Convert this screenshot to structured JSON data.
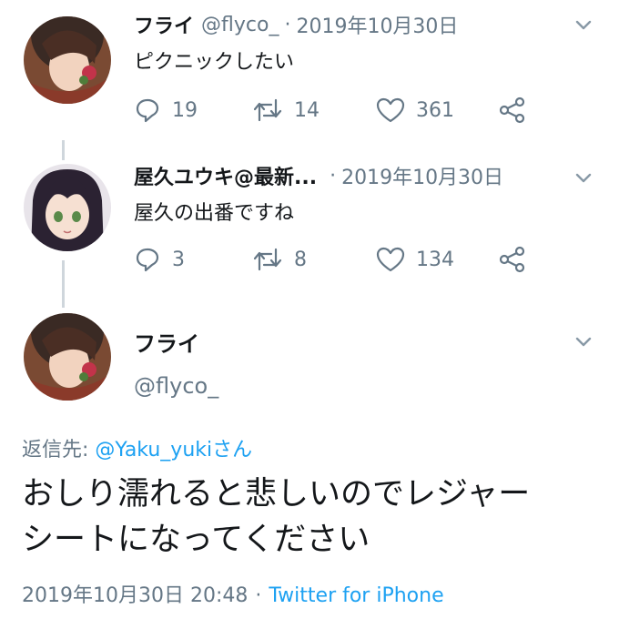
{
  "colors": {
    "text": "#14171a",
    "secondary": "#657786",
    "link": "#1da1f2",
    "thread_line": "#cfd6dc"
  },
  "tweet1": {
    "name": "フライ",
    "handle": "@flyco_",
    "dot": "·",
    "date": "2019年10月30日",
    "text": "ピクニックしたい",
    "replies": "19",
    "retweets": "14",
    "likes": "361"
  },
  "tweet2": {
    "name": "屋久ユウキ@最新...",
    "dot": "·",
    "date": "2019年10月30日",
    "text": "屋久の出番ですね",
    "replies": "3",
    "retweets": "8",
    "likes": "134"
  },
  "main": {
    "name": "フライ",
    "handle": "@flyco_",
    "replying_label": "返信先: ",
    "replying_to": "@Yaku_yukiさん",
    "text_line1": "おしり濡れると悲しいのでレジャー",
    "text_line2": "シートになってください",
    "timestamp": "2019年10月30日 20:48",
    "sep": "·",
    "source": "Twitter for iPhone"
  }
}
